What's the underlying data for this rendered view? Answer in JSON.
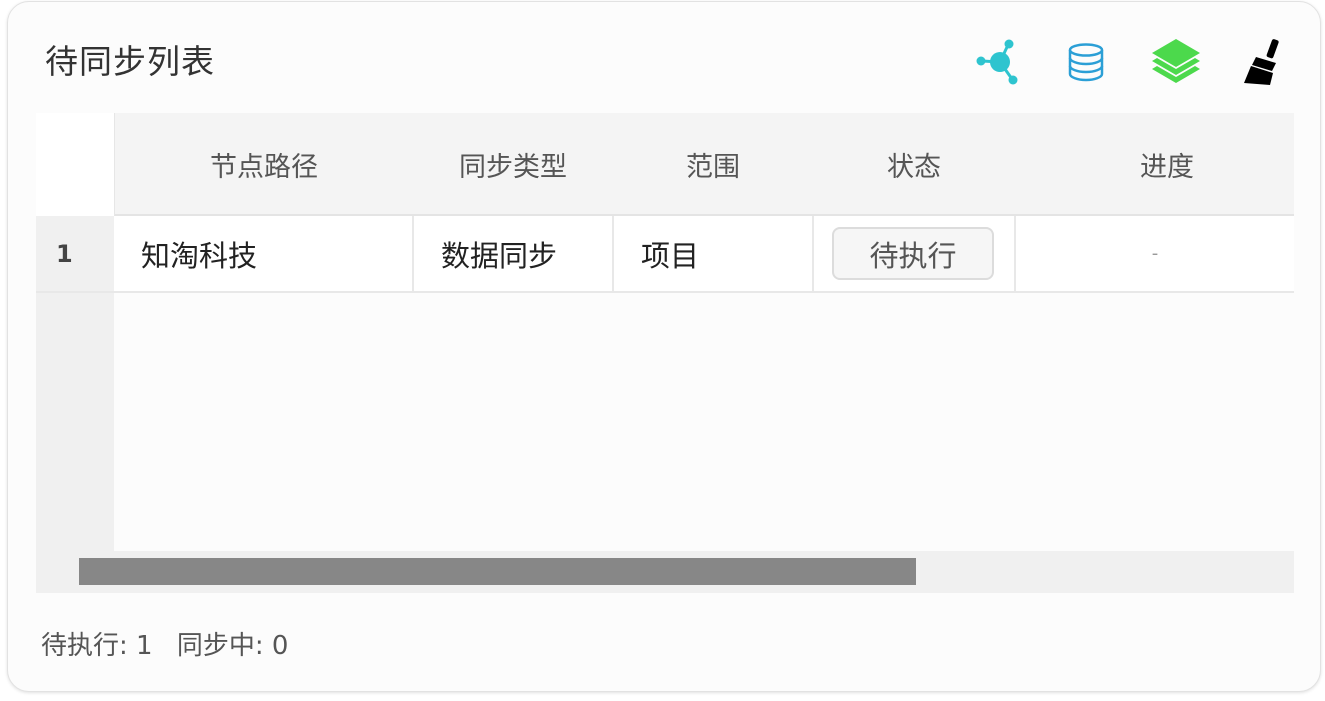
{
  "panel": {
    "title": "待同步列表",
    "toolbar": {
      "icons": [
        "graph-network-icon",
        "database-icon",
        "layers-icon",
        "broom-icon"
      ],
      "colors": {
        "graph": "#2ec4cf",
        "database": "#2b9fd6",
        "layers": "#4cd94c",
        "broom": "#000000"
      }
    }
  },
  "table": {
    "columns": [
      "节点路径",
      "同步类型",
      "范围",
      "状态",
      "进度"
    ],
    "rows": [
      {
        "index": "1",
        "path": "知淘科技",
        "type": "数据同步",
        "scope": "项目",
        "status": "待执行",
        "progress": "-"
      }
    ]
  },
  "footer": {
    "pending": "待执行: 1",
    "syncing": "同步中: 0"
  }
}
